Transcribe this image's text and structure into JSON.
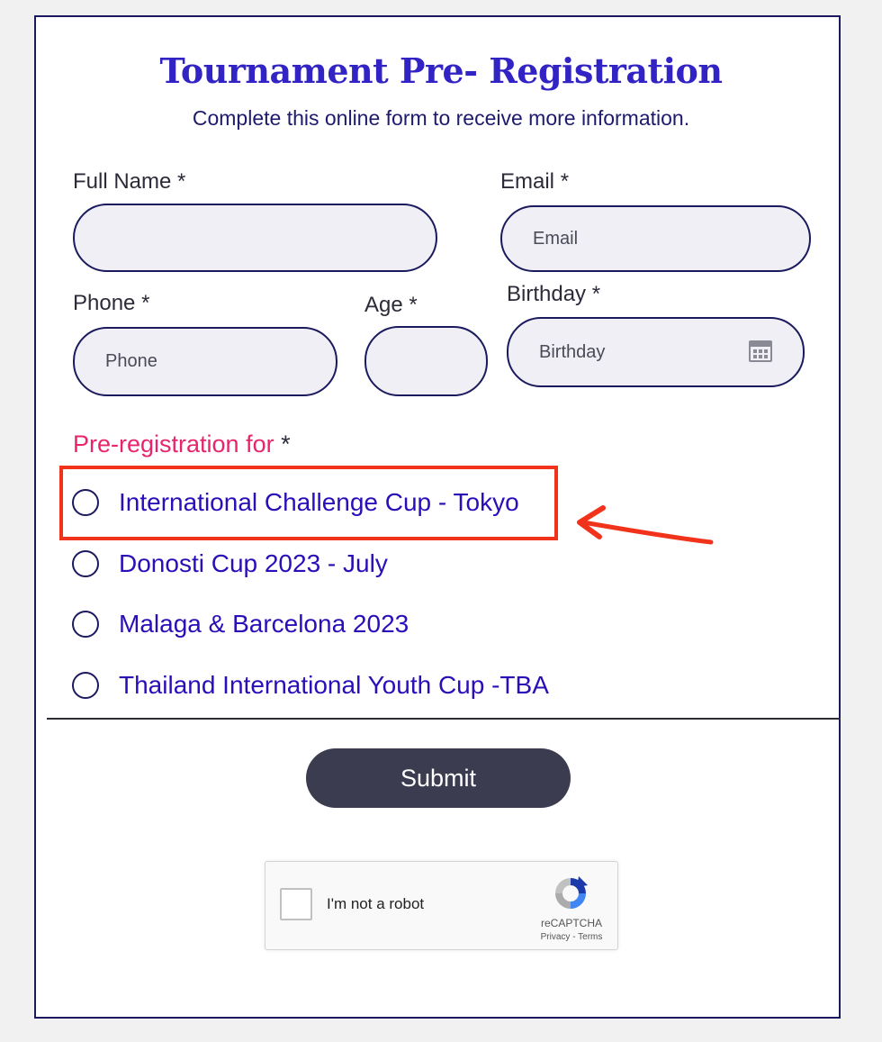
{
  "form": {
    "title": "Tournament Pre- Registration",
    "subtitle": "Complete this online form to receive more information."
  },
  "fields": {
    "full_name": {
      "label": "Full Name",
      "required_mark": "*",
      "value": "",
      "placeholder": ""
    },
    "email": {
      "label": "Email",
      "required_mark": "*",
      "value": "",
      "placeholder": "Email"
    },
    "phone": {
      "label": "Phone",
      "required_mark": "*",
      "value": "",
      "placeholder": "Phone"
    },
    "age": {
      "label": "Age",
      "required_mark": "*",
      "value": "",
      "placeholder": ""
    },
    "birthday": {
      "label": "Birthday",
      "required_mark": "*",
      "value": "",
      "placeholder": "Birthday",
      "icon": "calendar-icon"
    }
  },
  "preregistration": {
    "label": "Pre-registration for",
    "required_mark": "*",
    "options": [
      {
        "label": "International Challenge Cup - Tokyo",
        "selected": false
      },
      {
        "label": "Donosti Cup 2023 - July",
        "selected": false
      },
      {
        "label": "Malaga & Barcelona 2023",
        "selected": false
      },
      {
        "label": "Thailand International Youth Cup -TBA",
        "selected": false
      }
    ]
  },
  "annotation": {
    "highlight_color": "#f2331c",
    "highlighted_option": "International Challenge Cup - Tokyo",
    "arrow_icon": "hand-drawn-arrow-icon"
  },
  "submit": {
    "label": "Submit"
  },
  "recaptcha": {
    "checkbox_label": "I'm not a robot",
    "brand": "reCAPTCHA",
    "privacy": "Privacy",
    "separator": " - ",
    "terms": "Terms",
    "icon": "recaptcha-logo-icon"
  },
  "colors": {
    "title": "#3223c4",
    "option_text": "#2a0fb8",
    "section_label": "#e8246c",
    "field_bg": "#efeff5",
    "field_border": "#1b1a5e",
    "submit_bg": "#3b3c4f",
    "page_bg": "#f1f1f1"
  }
}
